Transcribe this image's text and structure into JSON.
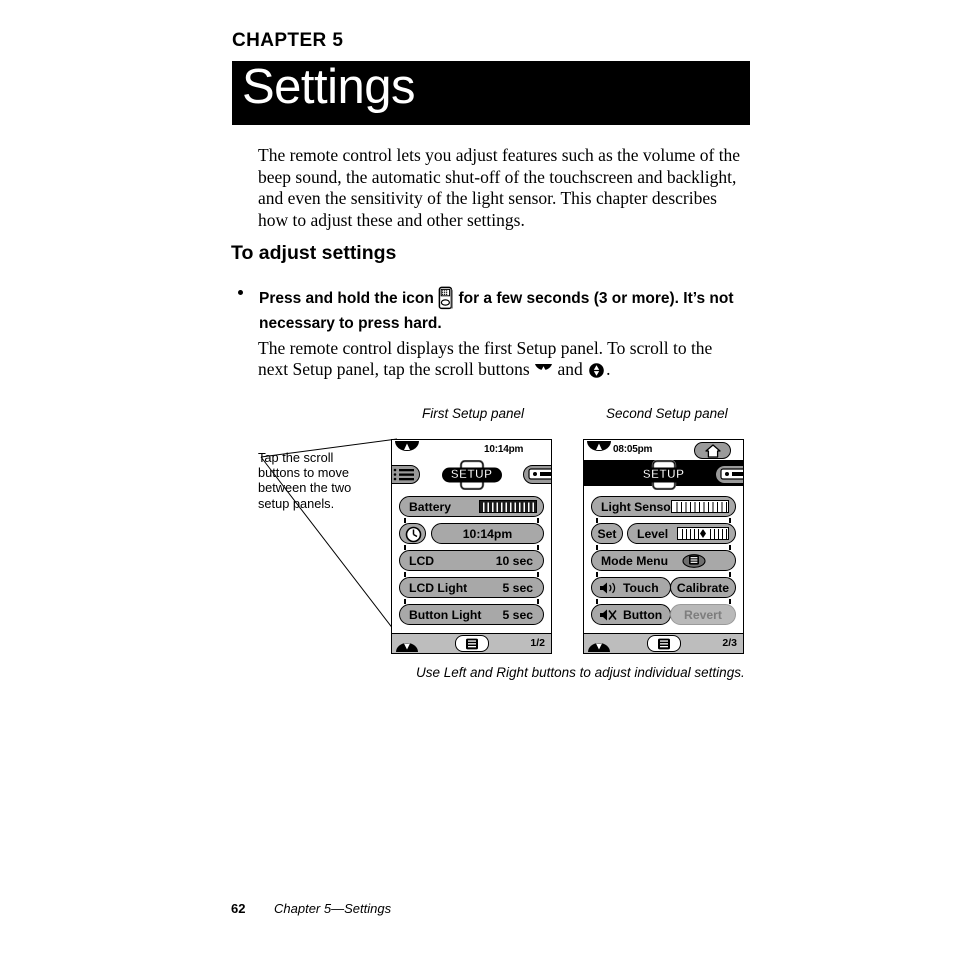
{
  "header": {
    "chapter_label": "CHAPTER 5",
    "title": "Settings"
  },
  "intro_paragraph": "The remote control lets you adjust features such as the volume of the beep sound, the automatic shut-off of the touchscreen and backlight, and even the sensitivity of the light sensor. This chapter describes how to adjust these and other settings.",
  "section": {
    "heading": "To adjust settings",
    "bullet": {
      "text_before_icon": "Press and hold the icon",
      "icon": "remote-control-icon",
      "text_after_icon": "for a few seconds (3 or more). It’s not necessary to press hard."
    },
    "paragraph": {
      "part1": "The remote control displays the first Setup panel. To scroll to the next Setup panel, tap the scroll buttons",
      "conjunction": "and",
      "period": ".",
      "icon_down": "scroll-down-button-icon",
      "icon_up": "scroll-up-button-icon"
    }
  },
  "callout": {
    "text": "Tap the scroll buttons to move between the two setup panels."
  },
  "figure": {
    "caption_first": "First Setup panel",
    "caption_second": "Second Setup panel",
    "caption_bottom": "Use Left and Right buttons to adjust individual settings."
  },
  "panel1": {
    "clock": "10:14pm",
    "setup_label": "SETUP",
    "scroll_top_icon": "scroll-up-icon",
    "left_button_icon": "list-menu-icon",
    "right_button_icon": "device-icon",
    "rows": [
      {
        "name": "battery",
        "label": "Battery",
        "gauge": "full"
      },
      {
        "name": "clock",
        "label": "10:14pm",
        "icon": "clock-icon"
      },
      {
        "name": "lcd",
        "label": "LCD",
        "value": "10 sec"
      },
      {
        "name": "lcd-light",
        "label": "LCD Light",
        "value": "5 sec"
      },
      {
        "name": "button-light",
        "label": "Button Light",
        "value": "5 sec"
      }
    ],
    "bottom": {
      "scroll_icon": "scroll-updown-icon",
      "menu_icon": "list-menu-icon",
      "page": "1/2"
    }
  },
  "panel2": {
    "clock": "08:05pm",
    "setup_label": "SETUP",
    "home_icon": "home-icon",
    "right_button_icon": "device-icon",
    "scroll_top_icon": "scroll-up-icon",
    "rows": [
      {
        "name": "light-sensor",
        "label": "Light Sensor",
        "gauge": "empty"
      },
      {
        "name": "level",
        "label": "Level",
        "set_label": "Set",
        "gauge": "marker"
      },
      {
        "name": "mode-menu",
        "label": "Mode Menu",
        "icon": "list-menu-icon"
      },
      {
        "name": "touch",
        "label": "Touch",
        "icon": "speaker-on-icon",
        "action": "Calibrate"
      },
      {
        "name": "button",
        "label": "Button",
        "icon": "speaker-mute-icon",
        "action": "Revert",
        "action_disabled": true
      }
    ],
    "bottom": {
      "scroll_icon": "scroll-updown-icon",
      "menu_icon": "list-menu-icon",
      "page": "2/3"
    }
  },
  "footer": {
    "page_number": "62",
    "running_title": "Chapter 5—Settings"
  },
  "colors": {
    "title_bar_bg": "#000000",
    "title_text": "#ffffff",
    "pill_bg": "#a8a8a8",
    "pill_light_bg": "#bdbdbd",
    "disabled_text": "#7d7d7d"
  }
}
